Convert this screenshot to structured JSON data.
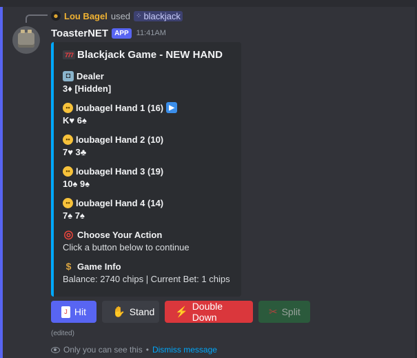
{
  "reply": {
    "user_name": "Lou Bagel",
    "used_text": "used",
    "command": "blackjack"
  },
  "message": {
    "bot_name": "ToasterNET",
    "app_tag": "APP",
    "timestamp": "11:41AM",
    "edited": "(edited)"
  },
  "embed": {
    "title": "Blackjack Game - NEW HAND",
    "accent_color": "#00a8fc",
    "fields": [
      {
        "icon": "robot-icon",
        "name": "Dealer",
        "value": "3♦ [Hidden]",
        "value_bold": true
      },
      {
        "icon": "player-face-icon",
        "name": "loubagel Hand 1 (16)",
        "value": "K♥ 6♠",
        "value_bold": true,
        "active_icon": "play-icon"
      },
      {
        "icon": "player-face-icon",
        "name": "loubagel Hand 2 (10)",
        "value": "7♥ 3♣",
        "value_bold": true
      },
      {
        "icon": "player-face-icon",
        "name": "loubagel Hand 3 (19)",
        "value": "10♠ 9♠",
        "value_bold": true
      },
      {
        "icon": "player-face-icon",
        "name": "loubagel Hand 4 (14)",
        "value": "7♠ 7♠",
        "value_bold": true
      },
      {
        "icon": "target-icon",
        "name": "Choose Your Action",
        "value": "Click a button below to continue",
        "value_bold": false
      },
      {
        "icon": "money-bag-icon",
        "name": "Game Info",
        "value": "Balance: 2740 chips | Current Bet: 1 chips",
        "value_bold": false
      }
    ]
  },
  "buttons": {
    "hit": "Hit",
    "stand": "Stand",
    "double_down": "Double Down",
    "split": "Split"
  },
  "footer": {
    "ephemeral_text": "Only you can see this",
    "separator": "•",
    "dismiss": "Dismiss message"
  },
  "colors": {
    "brand": "#5865f2",
    "danger": "#da373c",
    "success_disabled": "#2b5a3c",
    "link": "#00a8fc",
    "username": "#f0b232"
  }
}
